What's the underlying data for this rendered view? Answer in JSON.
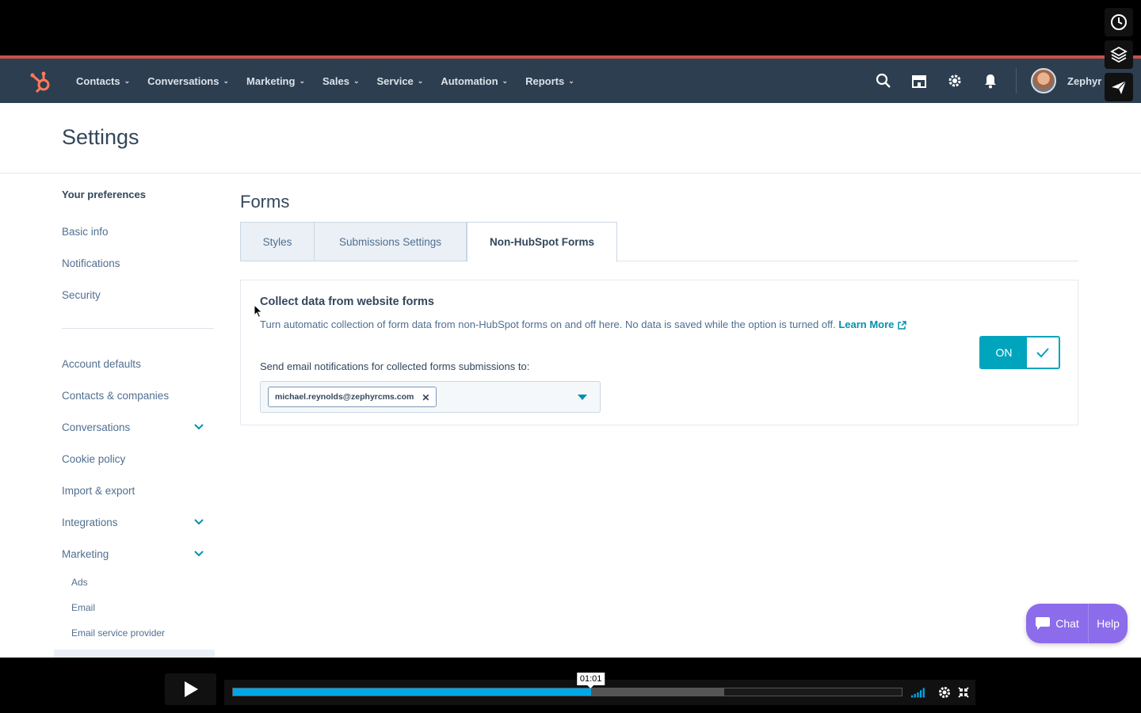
{
  "nav": {
    "items": [
      {
        "label": "Contacts"
      },
      {
        "label": "Conversations"
      },
      {
        "label": "Marketing"
      },
      {
        "label": "Sales"
      },
      {
        "label": "Service"
      },
      {
        "label": "Automation"
      },
      {
        "label": "Reports"
      }
    ],
    "account_name": "Zephyr"
  },
  "settings": {
    "title": "Settings"
  },
  "sidebar": {
    "section_heading": "Your preferences",
    "preferences": [
      {
        "label": "Basic info"
      },
      {
        "label": "Notifications"
      },
      {
        "label": "Security"
      }
    ],
    "account": [
      {
        "label": "Account defaults"
      },
      {
        "label": "Contacts & companies"
      },
      {
        "label": "Conversations"
      },
      {
        "label": "Cookie policy"
      },
      {
        "label": "Import & export"
      },
      {
        "label": "Integrations"
      },
      {
        "label": "Marketing"
      }
    ],
    "marketing_sub": [
      {
        "label": "Ads"
      },
      {
        "label": "Email"
      },
      {
        "label": "Email service provider"
      }
    ]
  },
  "main": {
    "title": "Forms",
    "tabs": [
      {
        "label": "Styles"
      },
      {
        "label": "Submissions Settings"
      },
      {
        "label": "Non-HubSpot Forms"
      }
    ],
    "card": {
      "title": "Collect data from website forms",
      "description": "Turn automatic collection of form data from non-HubSpot forms on and off here. No data is saved while the option is turned off. ",
      "learn_more": "Learn More",
      "notify_label": "Send email notifications for collected forms submissions to:",
      "email_tag": "michael.reynolds@zephyrcms.com",
      "toggle_label": "ON",
      "toggle_state": true
    }
  },
  "chat": {
    "chat_label": "Chat",
    "help_label": "Help"
  },
  "video": {
    "current_time": "01:01",
    "progress": 0.535,
    "buffered": 0.735
  },
  "colors": {
    "nav_bg": "#2d3e50",
    "accent": "#00a4bd",
    "link": "#0091ae",
    "chat": "#8c6cea",
    "progress": "#00a8e8"
  }
}
